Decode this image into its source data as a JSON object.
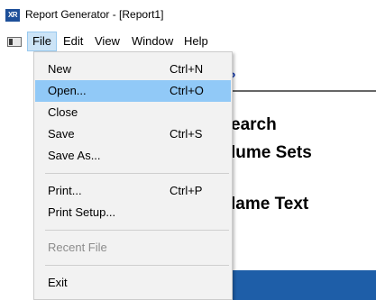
{
  "window": {
    "icon_text": "XR",
    "title": "Report Generator - [Report1]"
  },
  "menubar": {
    "items": [
      {
        "label": "File"
      },
      {
        "label": "Edit"
      },
      {
        "label": "View"
      },
      {
        "label": "Window"
      },
      {
        "label": "Help"
      }
    ]
  },
  "file_menu": {
    "items": [
      {
        "label": "New",
        "shortcut": "Ctrl+N"
      },
      {
        "label": "Open...",
        "shortcut": "Ctrl+O"
      },
      {
        "label": "Close",
        "shortcut": ""
      },
      {
        "label": "Save",
        "shortcut": "Ctrl+S"
      },
      {
        "label": "Save As...",
        "shortcut": ""
      },
      {
        "label": "Print...",
        "shortcut": "Ctrl+P"
      },
      {
        "label": "Print Setup...",
        "shortcut": ""
      },
      {
        "label": "Recent File",
        "shortcut": ""
      },
      {
        "label": "Exit",
        "shortcut": ""
      }
    ]
  },
  "document": {
    "help_glyph": "?",
    "line1": "earch",
    "line2": "lume Sets",
    "line3": "lame Text"
  },
  "colors": {
    "menu_highlight": "#91c9f7",
    "active_menu": "#cce4f7",
    "bottom_bar": "#1e5ea8",
    "app_icon": "#1d4f99"
  }
}
